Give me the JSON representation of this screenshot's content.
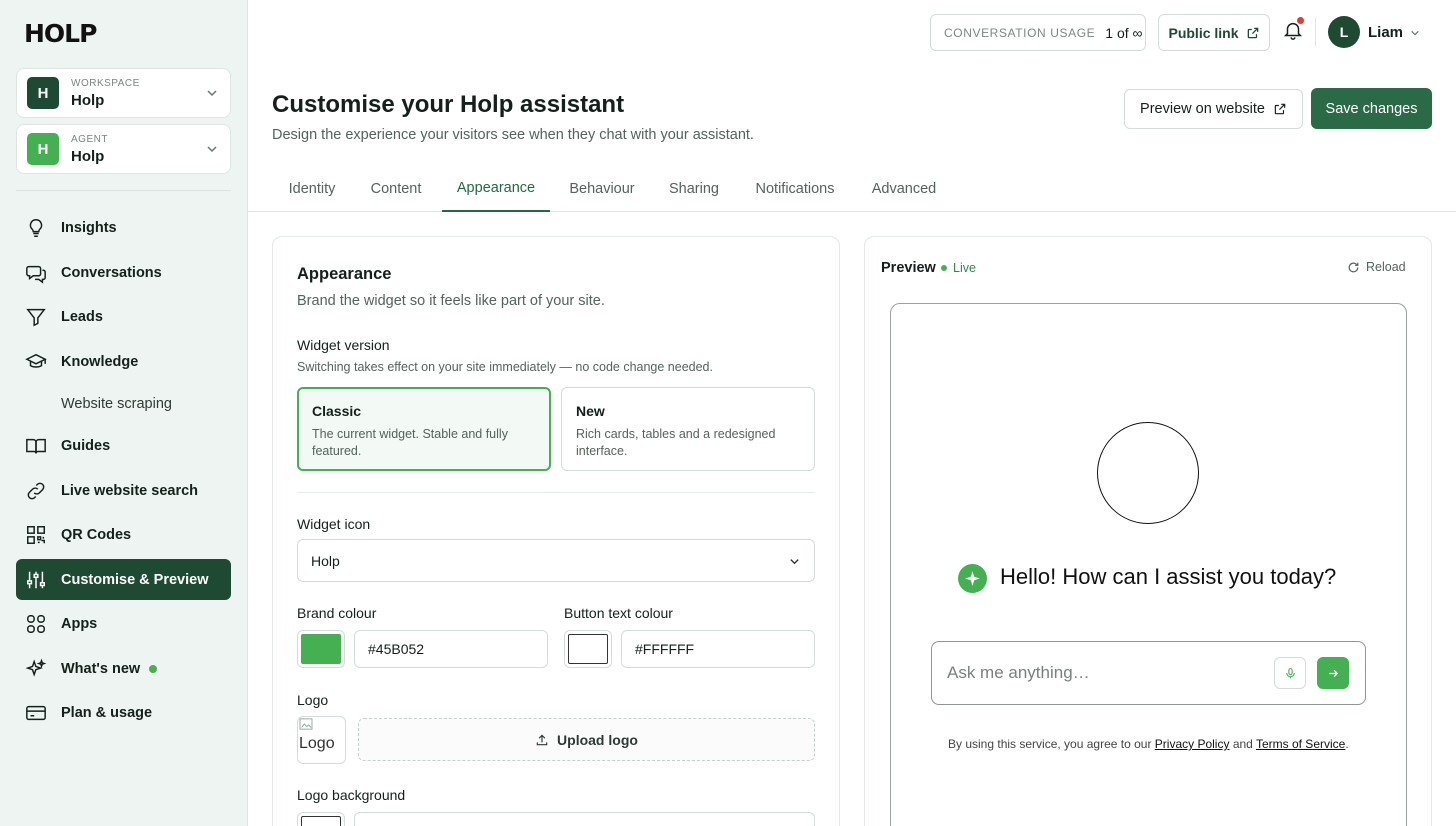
{
  "brand": {
    "logo_text": "HOLP"
  },
  "sidebar": {
    "workspace": {
      "caption": "WORKSPACE",
      "value": "Holp",
      "initial": "H",
      "color": "#1e4a34"
    },
    "agent": {
      "caption": "AGENT",
      "value": "Holp",
      "initial": "H",
      "color": "#45b052"
    },
    "items": [
      {
        "label": "Insights",
        "icon": "lightbulb-icon"
      },
      {
        "label": "Conversations",
        "icon": "chat-bubbles-icon"
      },
      {
        "label": "Leads",
        "icon": "funnel-icon"
      },
      {
        "label": "Knowledge",
        "icon": "graduation-cap-icon"
      },
      {
        "label": "Website scraping",
        "icon": ""
      },
      {
        "label": "Guides",
        "icon": "open-book-icon"
      },
      {
        "label": "Live website search",
        "icon": "link-icon"
      },
      {
        "label": "QR Codes",
        "icon": "qr-code-icon"
      },
      {
        "label": "Customise & Preview",
        "icon": "sliders-icon",
        "active": true
      },
      {
        "label": "Apps",
        "icon": "apps-grid-icon"
      },
      {
        "label": "What's new",
        "icon": "sparkles-icon"
      },
      {
        "label": "Plan & usage",
        "icon": "credit-card-icon"
      }
    ]
  },
  "topbar": {
    "usage_label": "CONVERSATION USAGE",
    "usage_value": "1 of ∞",
    "public_link": "Public link",
    "user_initial": "L",
    "user_name": "Liam"
  },
  "header": {
    "title": "Customise your Holp assistant",
    "subtitle": "Design the experience your visitors see when they chat with your assistant.",
    "preview_button": "Preview on website",
    "save_button": "Save changes"
  },
  "tabs": [
    "Identity",
    "Content",
    "Appearance",
    "Behaviour",
    "Sharing",
    "Notifications",
    "Advanced"
  ],
  "active_tab": "Appearance",
  "appearance": {
    "title": "Appearance",
    "subtitle": "Brand the widget so it feels like part of your site.",
    "widget_version": {
      "label": "Widget version",
      "hint": "Switching takes effect on your site immediately — no code change needed.",
      "options": [
        {
          "title": "Classic",
          "desc": "The current widget. Stable and fully featured.",
          "selected": true
        },
        {
          "title": "New",
          "desc": "Rich cards, tables and a redesigned interface.",
          "selected": false
        }
      ]
    },
    "widget_icon": {
      "label": "Widget icon",
      "value": "Holp"
    },
    "brand_colour": {
      "label": "Brand colour",
      "value": "#45B052"
    },
    "button_text_colour": {
      "label": "Button text colour",
      "value": "#FFFFFF"
    },
    "logo": {
      "label": "Logo",
      "alt": "Logo",
      "upload_label": "Upload logo"
    },
    "logo_background": {
      "label": "Logo background",
      "value": "#FFFFFF"
    }
  },
  "preview": {
    "title": "Preview",
    "status": "Live",
    "reload": "Reload",
    "greeting": "Hello! How can I assist you today?",
    "input_placeholder": "Ask me anything…",
    "legal_prefix": "By using this service, you agree to our",
    "privacy": "Privacy Policy",
    "and": "and",
    "terms": "Terms of Service",
    "legal_suffix": "."
  }
}
